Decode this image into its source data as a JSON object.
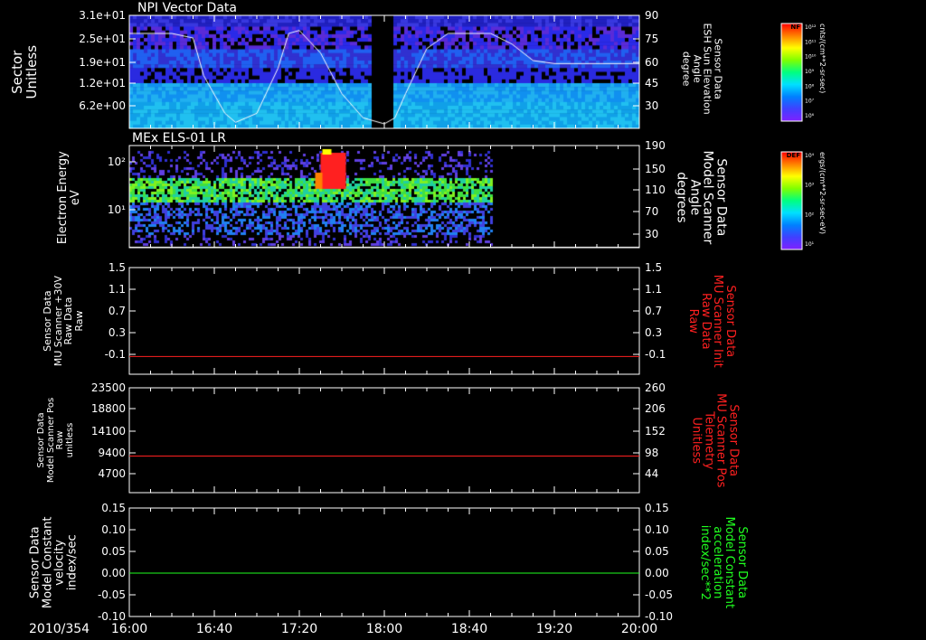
{
  "date_label": "2010/354",
  "x_ticks": [
    "16:00",
    "16:40",
    "17:20",
    "18:00",
    "18:40",
    "19:20",
    "20:00"
  ],
  "panels": [
    {
      "title": "NPI Vector Data",
      "left_label": [
        "Sector",
        "Unitless"
      ],
      "left_ticks": [
        "3.1e+01",
        "2.5e+01",
        "1.9e+01",
        "1.2e+01",
        "6.2e+00"
      ],
      "right_label": [
        "Sensor Data",
        "ESH Sun Elevation",
        "Angle",
        "degree"
      ],
      "right_ticks": [
        "90",
        "75",
        "60",
        "45",
        "30"
      ],
      "colorbar": {
        "title": "NF",
        "units": "cnts/(cm**2-sr-sec)",
        "ticks": [
          "10¹²",
          "10¹¹",
          "10¹⁰",
          "10⁹",
          "10⁸",
          "10⁷",
          "10⁶"
        ]
      }
    },
    {
      "title": "MEx ELS-01 LR",
      "left_label": [
        "Electron Energy",
        "eV"
      ],
      "left_ticks": [
        "10²",
        "10¹"
      ],
      "right_label": [
        "Sensor Data",
        "Model Scanner",
        "Angle",
        "degrees"
      ],
      "right_ticks": [
        "190",
        "150",
        "110",
        "70",
        "30"
      ],
      "colorbar": {
        "title": "DEF",
        "units": "ergs/(cm**2-sr-sec-eV)",
        "ticks": [
          "10⁴",
          "10³",
          "10²",
          "10¹"
        ]
      }
    },
    {
      "left_label": [
        "Sensor Data",
        "MU Scanner +30V",
        "Raw Data",
        "Raw"
      ],
      "left_ticks": [
        "1.5",
        "1.1",
        "0.7",
        "0.3",
        "-0.1"
      ],
      "right_label": [
        "Sensor Data",
        "MU Scanner Init",
        "Raw Data",
        "Raw"
      ],
      "right_ticks": [
        "1.5",
        "1.1",
        "0.7",
        "0.3",
        "-0.1"
      ]
    },
    {
      "left_label": [
        "Sensor Data",
        "Model Scanner Pos",
        "Raw",
        "unitless"
      ],
      "left_ticks": [
        "23500",
        "18800",
        "14100",
        "9400",
        "4700"
      ],
      "right_label": [
        "Sensor Data",
        "MU Scanner Pos",
        "Telemetry",
        "Unitless"
      ],
      "right_ticks": [
        "260",
        "206",
        "152",
        "98",
        "44"
      ]
    },
    {
      "left_label": [
        "Sensor Data",
        "Model Constant",
        "velocity",
        "index/sec"
      ],
      "left_ticks": [
        "0.15",
        "0.10",
        "0.05",
        "0.00",
        "-0.05",
        "-0.10"
      ],
      "right_label": [
        "Sensor Data",
        "Model Constant",
        "acceleration",
        "index/sec**2"
      ],
      "right_ticks": [
        "0.15",
        "0.10",
        "0.05",
        "0.00",
        "-0.05",
        "-0.10"
      ]
    }
  ],
  "chart_data": [
    {
      "type": "heatmap",
      "title": "NPI Vector Data",
      "x_range": [
        "16:00",
        "20:00"
      ],
      "ylabel": "Sector Unitless",
      "y2label": "Sensor Data ESH Sun Elevation Angle degree",
      "y2_range": [
        15,
        90
      ],
      "data_gap": [
        "17:54",
        "18:04"
      ],
      "sun_elevation": {
        "x": [
          "16:00",
          "16:20",
          "16:30",
          "16:35",
          "16:45",
          "16:50",
          "17:00",
          "17:10",
          "17:15",
          "17:20",
          "17:30",
          "17:40",
          "17:50",
          "18:00",
          "18:05",
          "18:10",
          "18:20",
          "18:30",
          "18:40",
          "18:50",
          "19:00",
          "19:10",
          "19:20",
          "20:00"
        ],
        "y": [
          78,
          78,
          75,
          50,
          25,
          19,
          25,
          55,
          78,
          80,
          65,
          38,
          22,
          18,
          22,
          38,
          68,
          78,
          78,
          78,
          71,
          60,
          58,
          58
        ]
      }
    },
    {
      "type": "heatmap",
      "title": "MEx ELS-01 LR",
      "x_range": [
        "16:00",
        "20:00"
      ],
      "ylabel": "Electron Energy eV",
      "y2label": "Sensor Data Model Scanner Angle degrees",
      "y2_range": [
        10,
        190
      ],
      "data_end": "18:50"
    },
    {
      "type": "line",
      "x": [
        "16:00",
        "20:00"
      ],
      "series": [
        {
          "values": [
            0,
            0
          ],
          "color": "#ff2020"
        }
      ],
      "ylim": [
        -0.3,
        1.5
      ]
    },
    {
      "type": "line",
      "x": [
        "16:00",
        "20:00"
      ],
      "series": [
        {
          "values": [
            8200,
            8200
          ],
          "color": "#ff2020"
        }
      ],
      "ylim": [
        0,
        23500
      ]
    },
    {
      "type": "line",
      "x": [
        "16:00",
        "20:00"
      ],
      "series": [
        {
          "values": [
            0,
            0
          ],
          "color": "#20ff20"
        }
      ],
      "ylim": [
        -0.1,
        0.15
      ]
    }
  ],
  "colors": {
    "axis": "#ffffff",
    "right_label_red": "#ff2020",
    "right_label_green": "#20ff20"
  }
}
